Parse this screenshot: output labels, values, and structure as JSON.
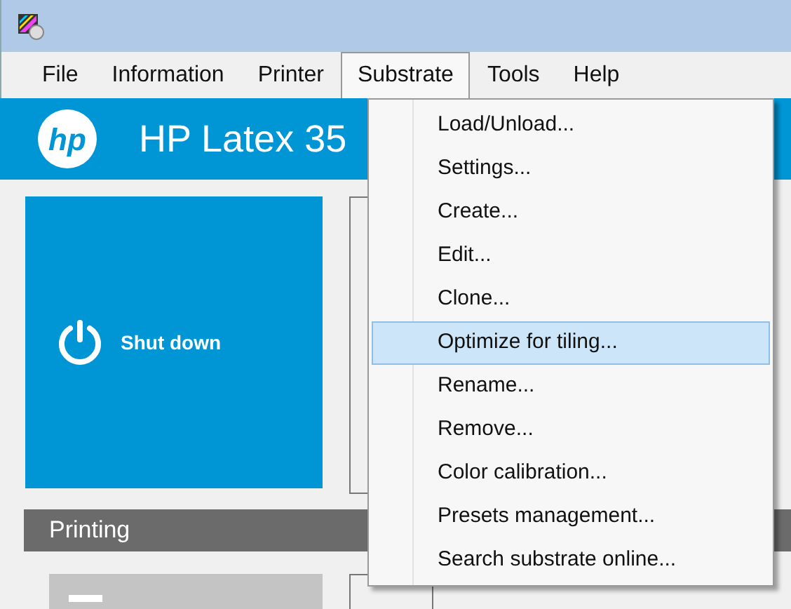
{
  "menu_bar": [
    {
      "label": "File",
      "selected": false
    },
    {
      "label": "Information",
      "selected": false
    },
    {
      "label": "Printer",
      "selected": false
    },
    {
      "label": "Substrate",
      "selected": true
    },
    {
      "label": "Tools",
      "selected": false
    },
    {
      "label": "Help",
      "selected": false
    }
  ],
  "header": {
    "logo": "hp",
    "title": "HP Latex 35"
  },
  "shutdown_tile": {
    "label": "Shut down"
  },
  "printing_section": {
    "title": "Printing"
  },
  "substrate_menu": [
    {
      "label": "Load/Unload...",
      "selected": false
    },
    {
      "label": "Settings...",
      "selected": false
    },
    {
      "label": "Create...",
      "selected": false
    },
    {
      "label": "Edit...",
      "selected": false
    },
    {
      "label": "Clone...",
      "selected": false
    },
    {
      "label": "Optimize for tiling...",
      "selected": true
    },
    {
      "label": "Rename...",
      "selected": false
    },
    {
      "label": "Remove...",
      "selected": false
    },
    {
      "label": "Color calibration...",
      "selected": false
    },
    {
      "label": "Presets management...",
      "selected": false
    },
    {
      "label": "Search substrate online...",
      "selected": false
    }
  ]
}
